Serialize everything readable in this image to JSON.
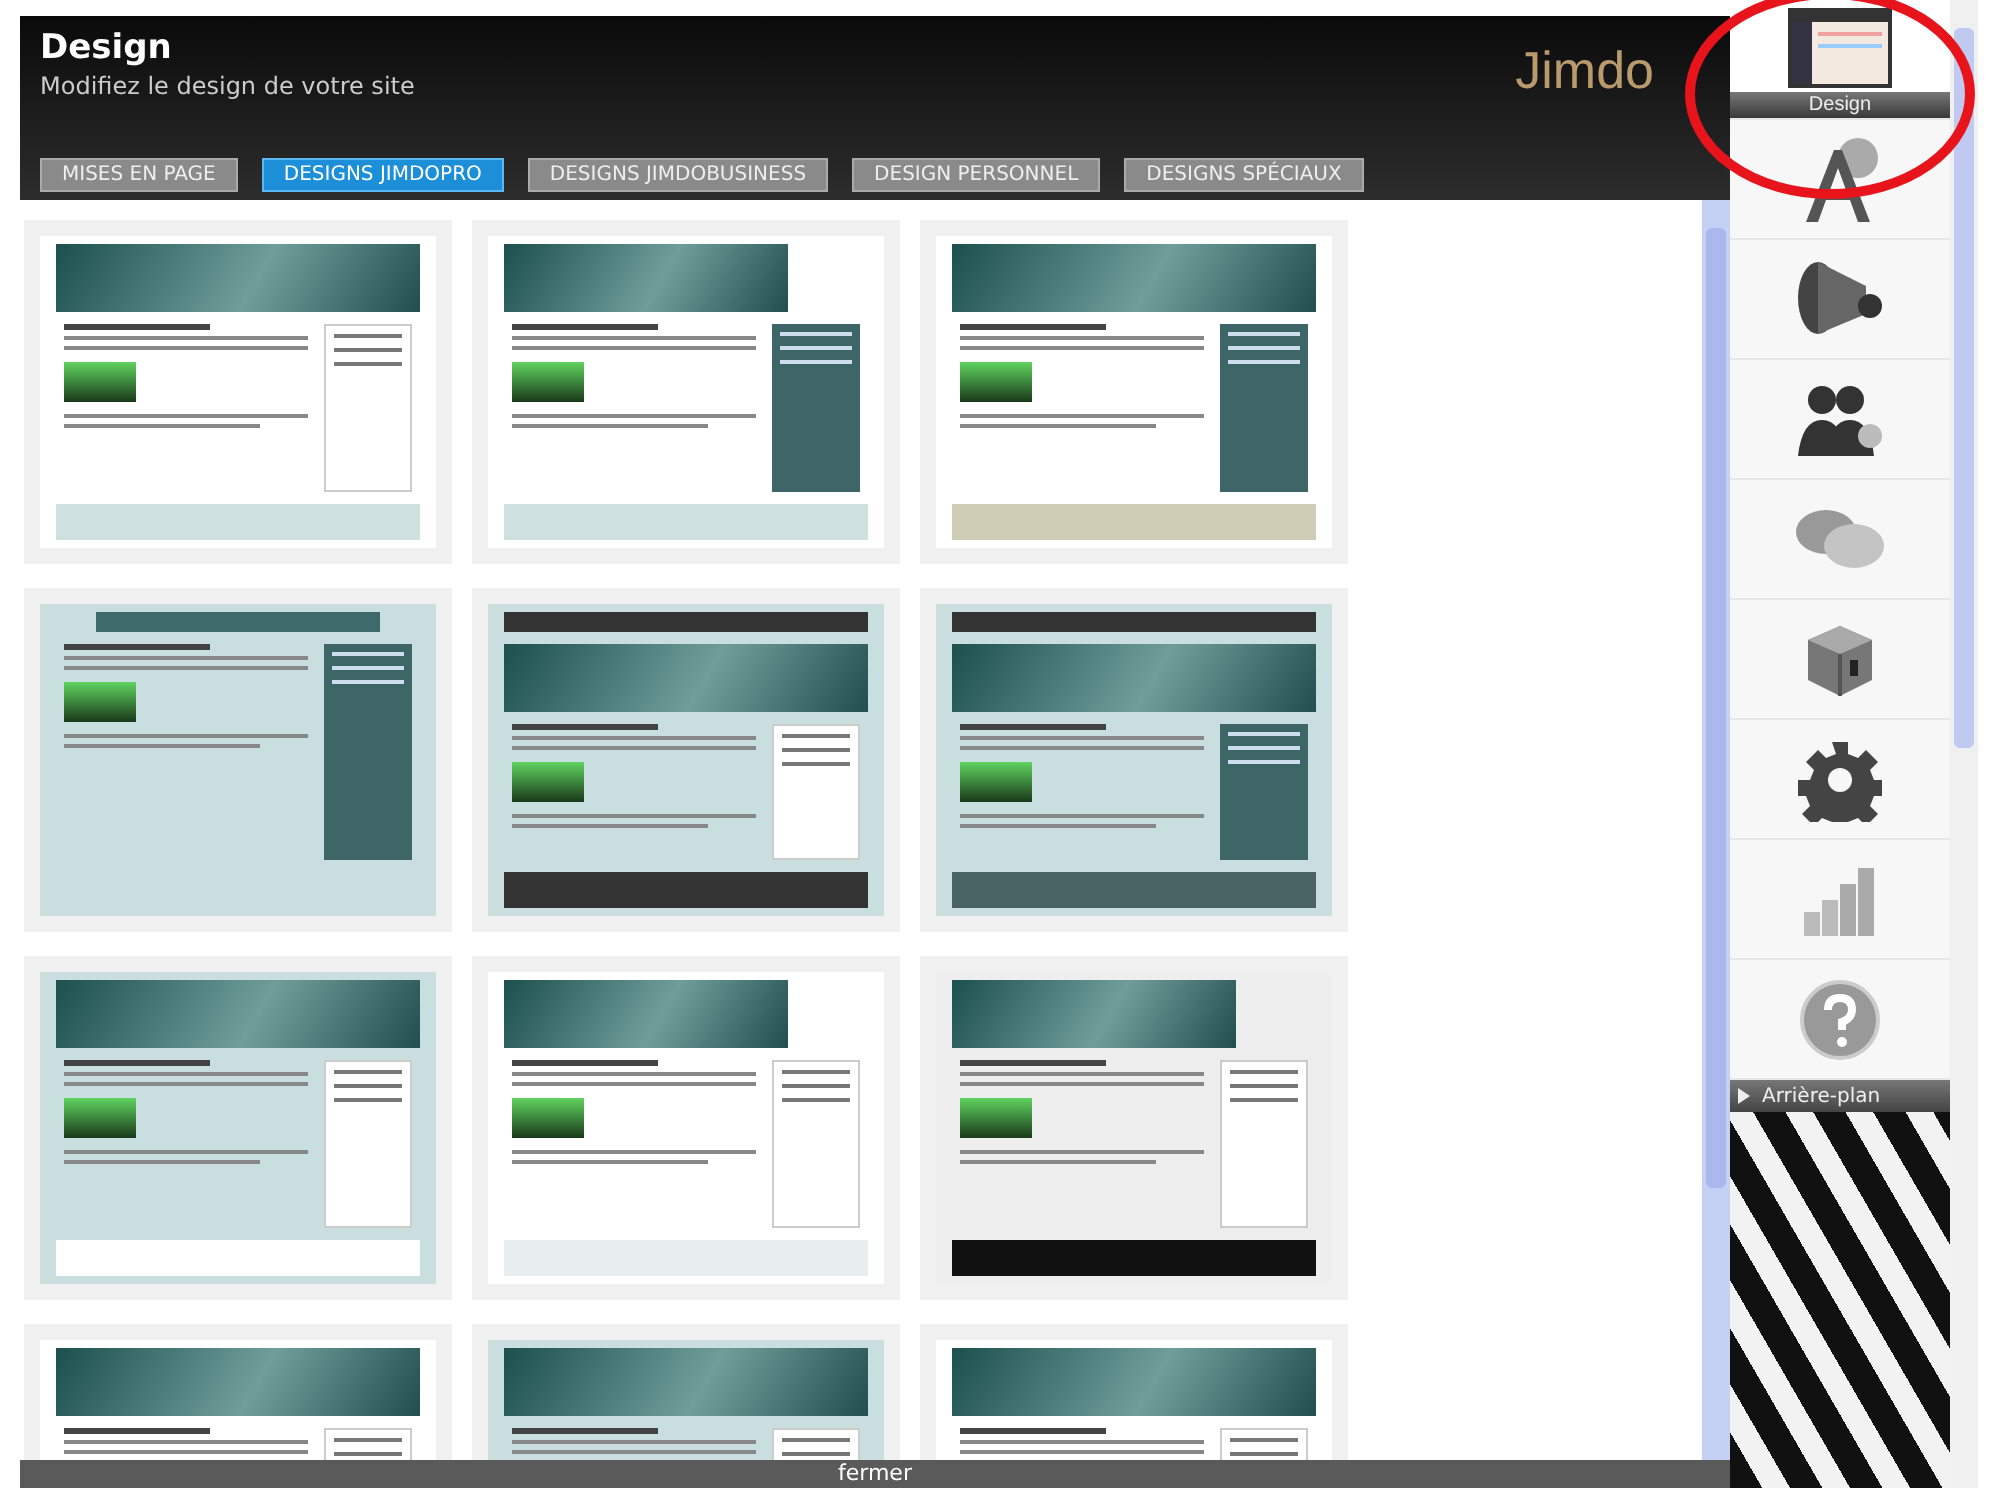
{
  "header": {
    "title": "Design",
    "subtitle": "Modifiez le design de votre site",
    "logo": "Jimdo"
  },
  "tabs": [
    {
      "label": "MISES EN PAGE",
      "selected": false
    },
    {
      "label": "DESIGNS JIMDOPRO",
      "selected": true
    },
    {
      "label": "DESIGNS JIMDOBUSINESS",
      "selected": false
    },
    {
      "label": "DESIGN PERSONNEL",
      "selected": false
    },
    {
      "label": "DESIGNS SPÉCIAUX",
      "selected": false
    }
  ],
  "designs": [
    {
      "kind": "classic"
    },
    {
      "kind": "right-panel"
    },
    {
      "kind": "olive"
    },
    {
      "kind": "boxed"
    },
    {
      "kind": "dark-nav"
    },
    {
      "kind": "grid"
    },
    {
      "kind": "framed"
    },
    {
      "kind": "gradient"
    },
    {
      "kind": "side-header"
    },
    {
      "kind": "classic"
    },
    {
      "kind": "framed"
    },
    {
      "kind": "classic"
    }
  ],
  "sidebar": {
    "items": [
      {
        "kind": "layout",
        "label": "Design",
        "selected": true
      },
      {
        "kind": "typography",
        "selected": false
      },
      {
        "kind": "megaphone",
        "selected": false
      },
      {
        "kind": "users",
        "selected": false
      },
      {
        "kind": "chat",
        "selected": false
      },
      {
        "kind": "box",
        "selected": false
      },
      {
        "kind": "gear",
        "selected": false
      },
      {
        "kind": "chart",
        "selected": false
      },
      {
        "kind": "help",
        "selected": false
      }
    ],
    "section": {
      "label": "Arrière-plan"
    }
  },
  "footer": {
    "close": "fermer"
  }
}
